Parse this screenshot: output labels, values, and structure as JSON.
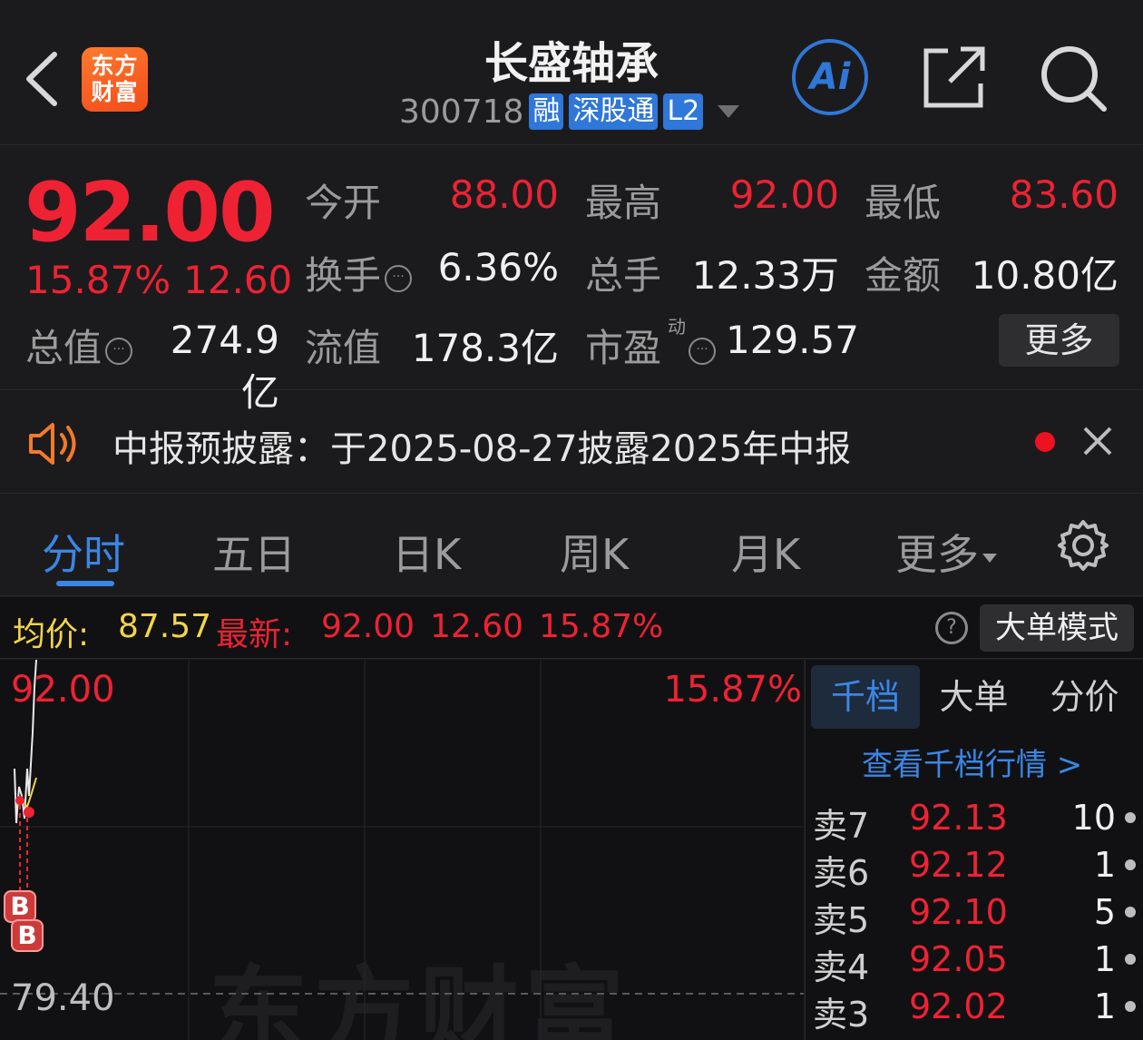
{
  "header": {
    "logo_line1": "东方",
    "logo_line2": "财富",
    "title": "长盛轴承",
    "code": "300718",
    "tags": [
      "融",
      "深股通",
      "L2"
    ],
    "ai_label": "Ai"
  },
  "quote": {
    "price": "92.00",
    "change_pct": "15.87%",
    "change": "12.60",
    "open_label": "今开",
    "open": "88.00",
    "high_label": "最高",
    "high": "92.00",
    "low_label": "最低",
    "low": "83.60",
    "turnover_label": "换手",
    "turnover": "6.36%",
    "volume_label": "总手",
    "volume": "12.33万",
    "amount_label": "金额",
    "amount": "10.80亿",
    "mktcap_label": "总值",
    "mktcap": "274.9亿",
    "float_label": "流值",
    "float": "178.3亿",
    "pe_label": "市盈",
    "pe_sup": "动",
    "pe": "129.57",
    "more_label": "更多"
  },
  "notice": {
    "text": "中报预披露：于2025-08-27披露2025年中报"
  },
  "tabs": {
    "items": [
      "分时",
      "五日",
      "日K",
      "周K",
      "月K",
      "更多"
    ]
  },
  "avgbar": {
    "avg_label": "均价:",
    "avg": "87.57",
    "latest_label": "最新:",
    "latest": "92.00",
    "change": "12.60",
    "pct": "15.87%",
    "big_order_label": "大单模式"
  },
  "chart": {
    "top_price": "92.00",
    "top_pct": "15.87%",
    "low_price": "79.40",
    "watermark": "东方财富",
    "marker_b": "B"
  },
  "book": {
    "tabs": [
      "千档",
      "大单",
      "分价"
    ],
    "link": "查看千档行情 >",
    "rows": [
      {
        "side": "卖7",
        "price": "92.13",
        "qty": "10"
      },
      {
        "side": "卖6",
        "price": "92.12",
        "qty": "1"
      },
      {
        "side": "卖5",
        "price": "92.10",
        "qty": "5"
      },
      {
        "side": "卖4",
        "price": "92.05",
        "qty": "1"
      },
      {
        "side": "卖3",
        "price": "92.02",
        "qty": "1"
      }
    ]
  },
  "colors": {
    "up": "#ee2233",
    "accent": "#3a86e6",
    "avg": "#f3d34a",
    "bg": "#1b1b1d"
  }
}
